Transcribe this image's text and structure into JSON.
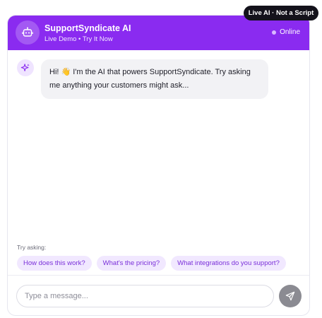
{
  "badge": {
    "text": "Live AI · Not a Script"
  },
  "header": {
    "title": "SupportSyndicate AI",
    "subtitle": "Live Demo • Try It Now",
    "status": "Online",
    "avatar_icon": "robot-icon"
  },
  "messages": [
    {
      "from": "bot",
      "icon": "sparkles-icon",
      "text": "Hi! 👋 I'm the AI that powers SupportSyndicate. Try asking me anything your customers might ask..."
    }
  ],
  "suggestions": {
    "label": "Try asking:",
    "items": [
      "How does this work?",
      "What's the pricing?",
      "What integrations do you support?"
    ]
  },
  "composer": {
    "placeholder": "Type a message...",
    "value": "",
    "send_icon": "send-icon"
  },
  "colors": {
    "accent": "#8a2bf0",
    "chip_bg": "#f1e8ff",
    "chip_text": "#7a2fd9",
    "send_bg": "#8b8b92"
  }
}
